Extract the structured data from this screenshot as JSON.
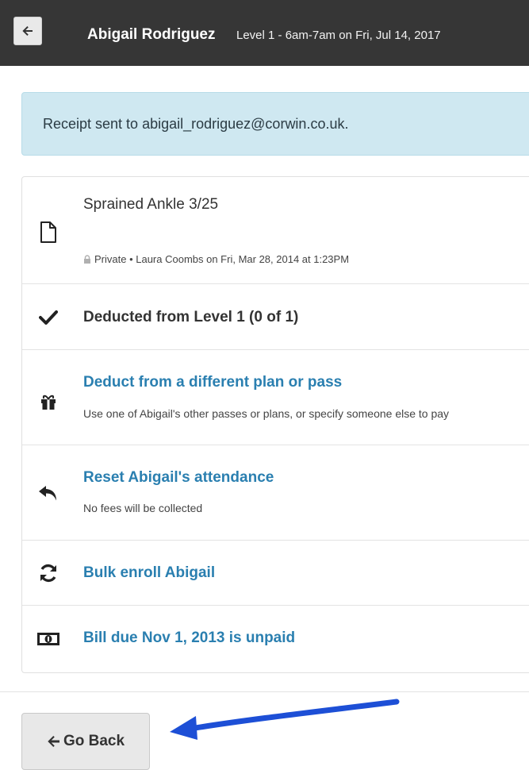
{
  "header": {
    "back_icon": "arrow-left-icon",
    "name": "Abigail Rodriguez",
    "subtitle": "Level 1 - 6am-7am on Fri, Jul 14, 2017"
  },
  "alert": {
    "text": "Receipt sent to abigail_rodriguez@corwin.co.uk."
  },
  "items": [
    {
      "icon": "document-icon",
      "title": "Sprained Ankle 3/25",
      "meta_lock_icon": "lock-icon",
      "meta": "Private • Laura Coombs on Fri, Mar 28, 2014 at 1:23PM"
    },
    {
      "icon": "checkmark-icon",
      "title": "Deducted from Level 1 (0 of 1)"
    },
    {
      "icon": "gift-icon",
      "title": "Deduct from a different plan or pass",
      "description": "Use one of Abigail's other passes or plans, or specify someone else to pay"
    },
    {
      "icon": "undo-arrow-icon",
      "title": "Reset Abigail's attendance",
      "description": "No fees will be collected"
    },
    {
      "icon": "refresh-icon",
      "title": "Bulk enroll Abigail"
    },
    {
      "icon": "money-bill-icon",
      "title": "Bill due Nov 1, 2013 is unpaid"
    }
  ],
  "footer": {
    "go_back_icon": "arrow-left-icon",
    "go_back_label": "Go Back"
  },
  "colors": {
    "header_bg": "#363636",
    "alert_bg": "#cfe8f1",
    "link": "#2a7fb0",
    "annotation_arrow": "#1d4fd6"
  }
}
